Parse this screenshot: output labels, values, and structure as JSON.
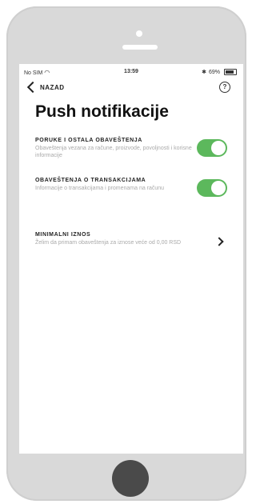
{
  "status": {
    "carrier": "No SIM",
    "time": "13:59",
    "battery": "69%"
  },
  "nav": {
    "back_label": "NAZAD",
    "help_symbol": "?"
  },
  "page": {
    "title": "Push notifikacije"
  },
  "settings": [
    {
      "title": "PORUKE I OSTALA OBAVEŠTENJA",
      "description": "Obaveštenja vezana za račune, proizvode, povoljnosti i korisne informacije",
      "enabled": true
    },
    {
      "title": "OBAVEŠTENJA O TRANSAKCIJAMA",
      "description": "Informacije o transakcijama i promenama na računu",
      "enabled": true
    },
    {
      "title": "MINIMALNI IZNOS",
      "description": "Želim da primam obaveštenja za iznose veće od 0,00 RSD"
    }
  ],
  "colors": {
    "toggle_on": "#5cb85c",
    "phone_body": "#d9d9d9",
    "home_button": "#4a4a4a"
  }
}
